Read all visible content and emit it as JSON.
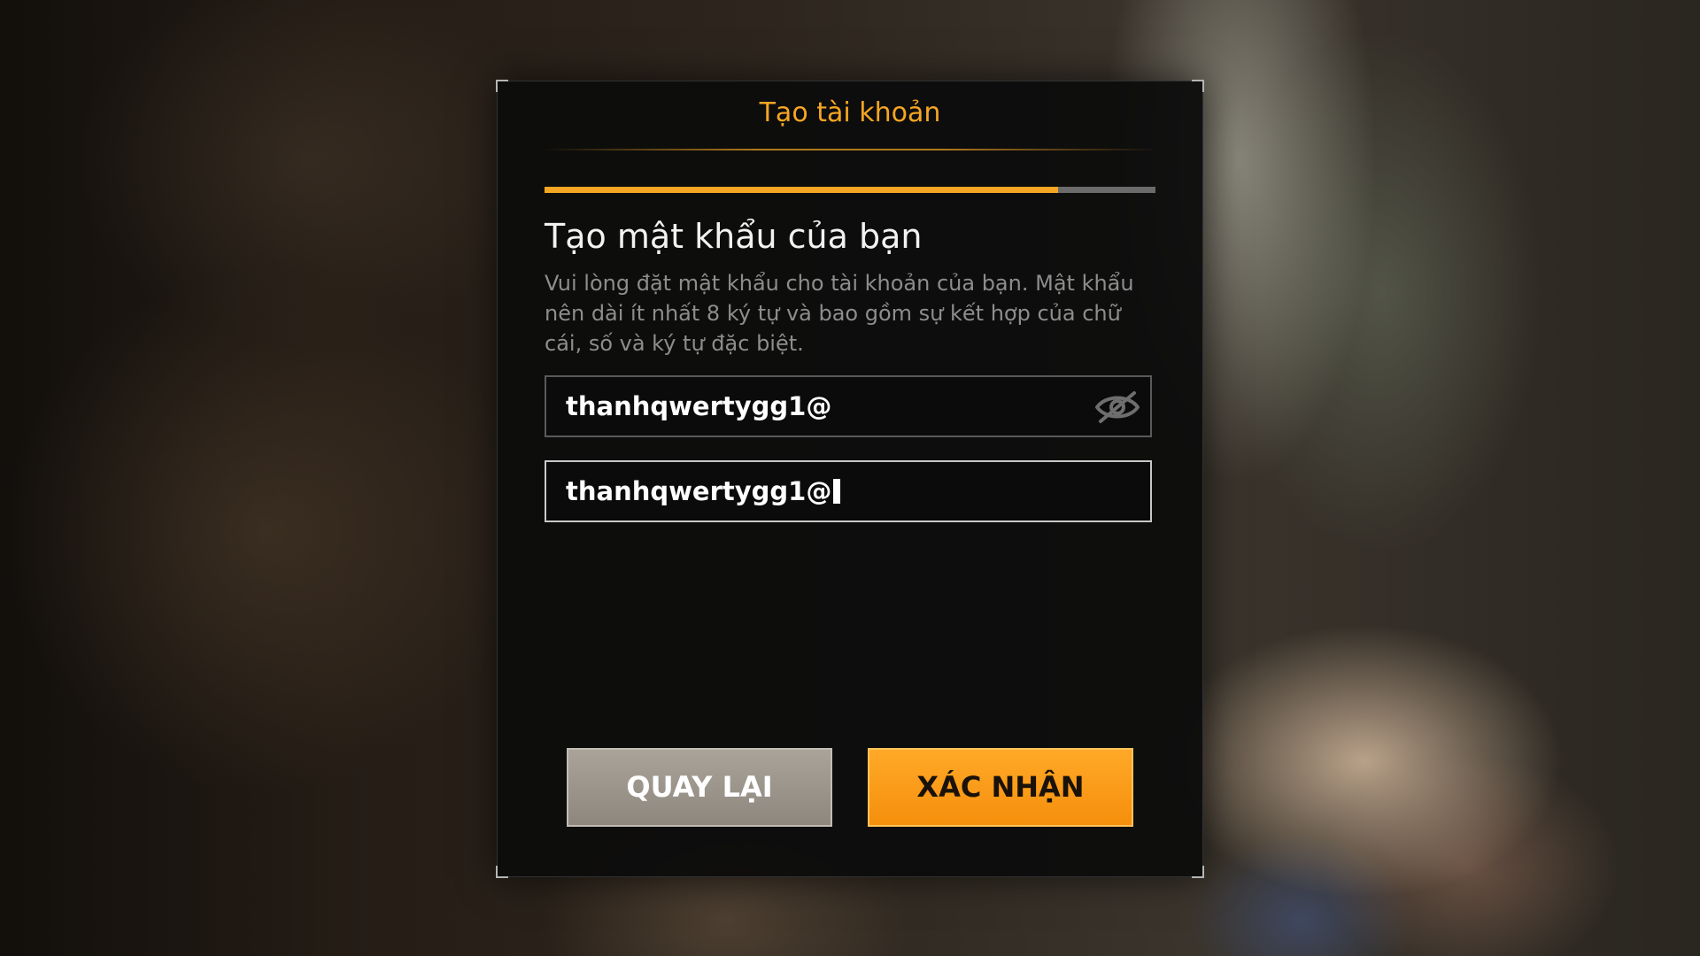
{
  "dialog": {
    "title": "Tạo tài khoản",
    "progress": 0.84,
    "heading": "Tạo mật khẩu của bạn",
    "description": "Vui lòng đặt mật khẩu cho tài khoản của bạn. Mật khẩu nên dài ít nhất 8 ký tự và bao gồm sự kết hợp của chữ cái, số và ký tự đặc biệt."
  },
  "fields": {
    "password_value": "thanhqwertygg1@",
    "password_icon": "eye-slash-icon",
    "confirm_value": "thanhqwertygg1@"
  },
  "buttons": {
    "back_label": "QUAY LẠI",
    "confirm_label": "XÁC NHẬN"
  },
  "colors": {
    "accent": "#f5a623",
    "progress_track": "#6b6b6b",
    "back_button": "#a49e95",
    "confirm_button": "#ffa01c"
  }
}
